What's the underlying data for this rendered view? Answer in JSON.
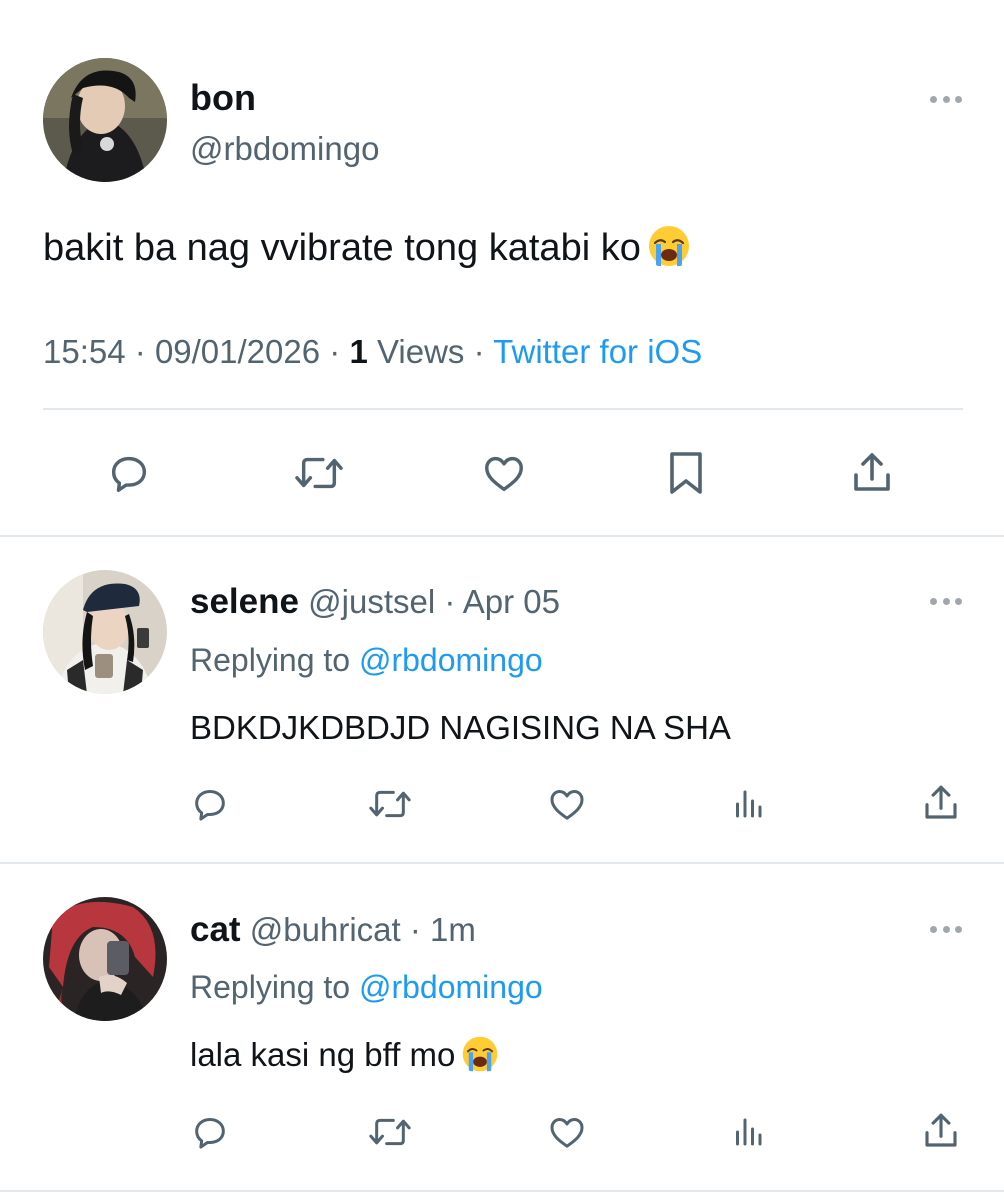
{
  "main_tweet": {
    "display_name": "bon",
    "handle": "@rbdomingo",
    "text": "bakit ba nag vvibrate tong katabi ko",
    "text_emoji": "loudly-crying-face",
    "time": "15:54",
    "date": "09/01/2026",
    "views_count": "1",
    "views_label": "Views",
    "separator": "·",
    "source": "Twitter for iOS",
    "actions": [
      "reply-icon",
      "retweet-icon",
      "like-icon",
      "bookmark-icon",
      "share-icon"
    ]
  },
  "replies": [
    {
      "display_name": "selene",
      "handle": "@justsel",
      "time": "Apr 05",
      "replying_prefix": "Replying to",
      "replying_to": "@rbdomingo",
      "text": "BDKDJKDBDJD NAGISING NA SHA",
      "actions": [
        "reply-icon",
        "retweet-icon",
        "like-icon",
        "views-icon",
        "share-icon"
      ]
    },
    {
      "display_name": "cat",
      "handle": "@buhricat",
      "time": "1m",
      "replying_prefix": "Replying to",
      "replying_to": "@rbdomingo",
      "text": "lala kasi ng bff mo",
      "text_emoji": "loudly-crying-face",
      "actions": [
        "reply-icon",
        "retweet-icon",
        "like-icon",
        "views-icon",
        "share-icon"
      ]
    }
  ],
  "colors": {
    "text_primary": "#0f1419",
    "text_secondary": "#536471",
    "link": "#1d9bf0",
    "divider": "#e3e8ec",
    "icon": "#536471"
  }
}
